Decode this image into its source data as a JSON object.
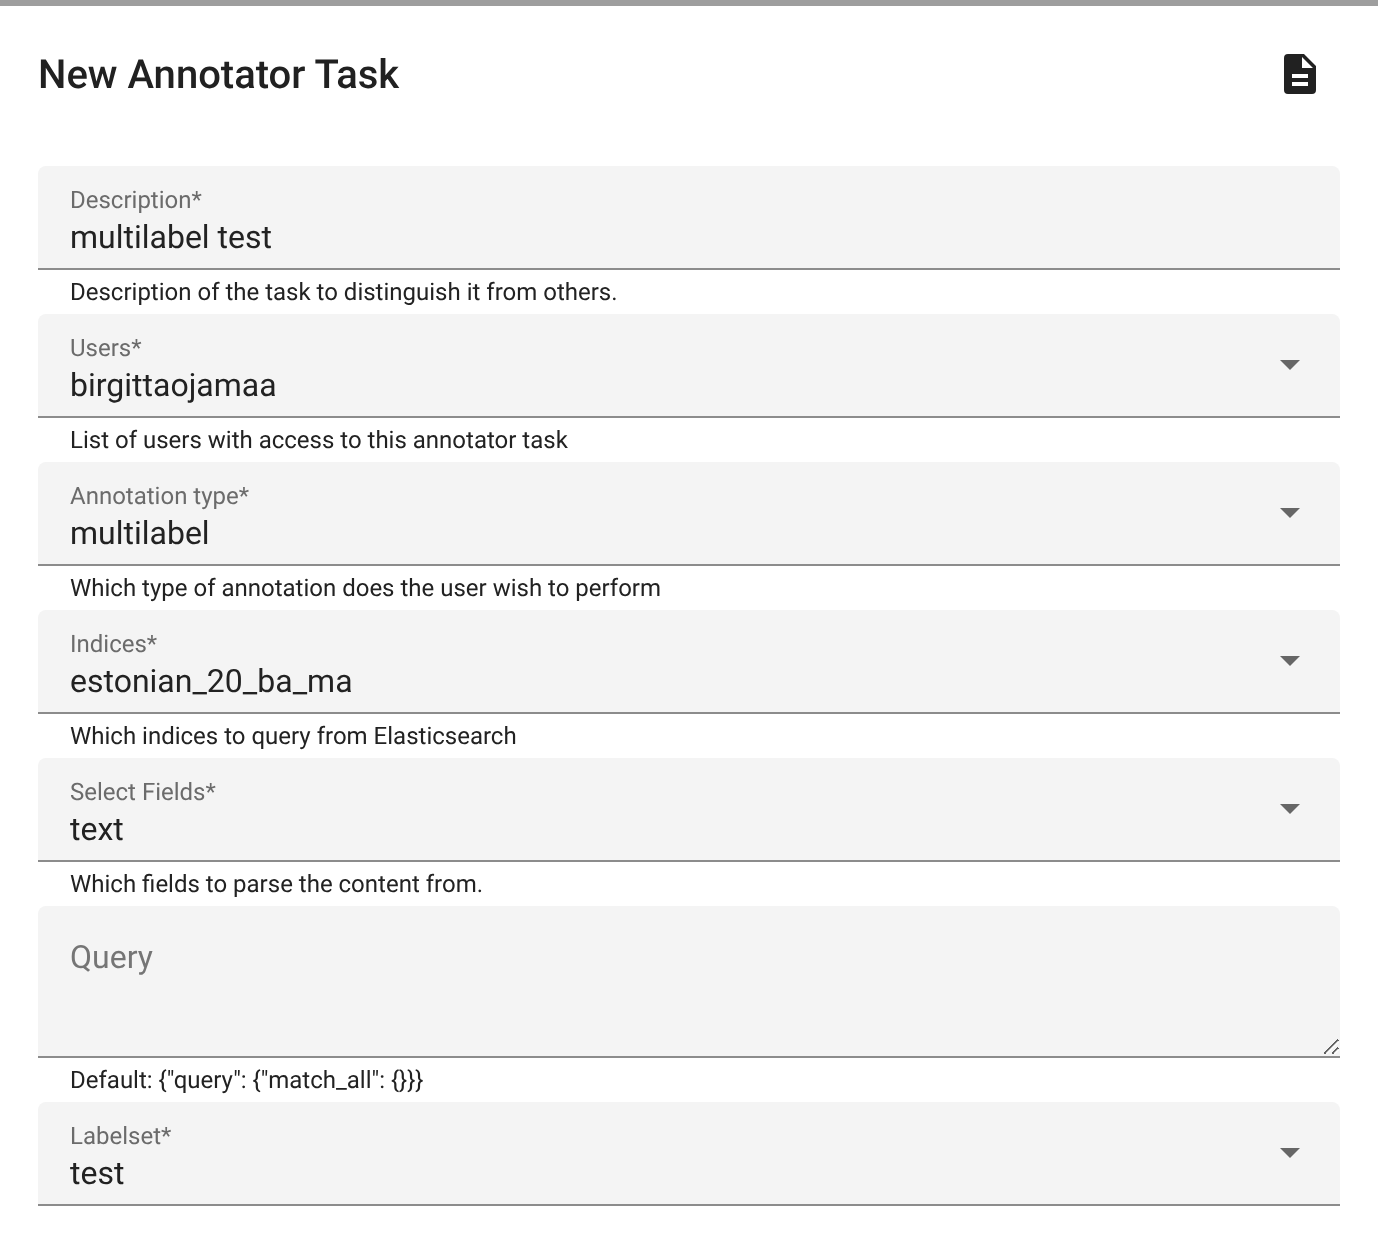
{
  "title": "New Annotator Task",
  "fields": [
    {
      "kind": "text",
      "label": "Description*",
      "value": "multilabel test",
      "hint": "Description of the task to distinguish it from others."
    },
    {
      "kind": "select",
      "label": "Users*",
      "value": "birgittaojamaa",
      "hint": "List of users with access to this annotator task"
    },
    {
      "kind": "select",
      "label": "Annotation type*",
      "value": "multilabel",
      "hint": "Which type of annotation does the user wish to perform"
    },
    {
      "kind": "select",
      "label": "Indices*",
      "value": "estonian_20_ba_ma",
      "hint": "Which indices to query from Elasticsearch"
    },
    {
      "kind": "select",
      "label": "Select Fields*",
      "value": "text",
      "hint": "Which fields to parse the content from."
    },
    {
      "kind": "textarea",
      "placeholder": "Query",
      "hint": "Default: {\"query\": {\"match_all\": {}}}"
    },
    {
      "kind": "select",
      "label": "Labelset*",
      "value": "test"
    }
  ]
}
